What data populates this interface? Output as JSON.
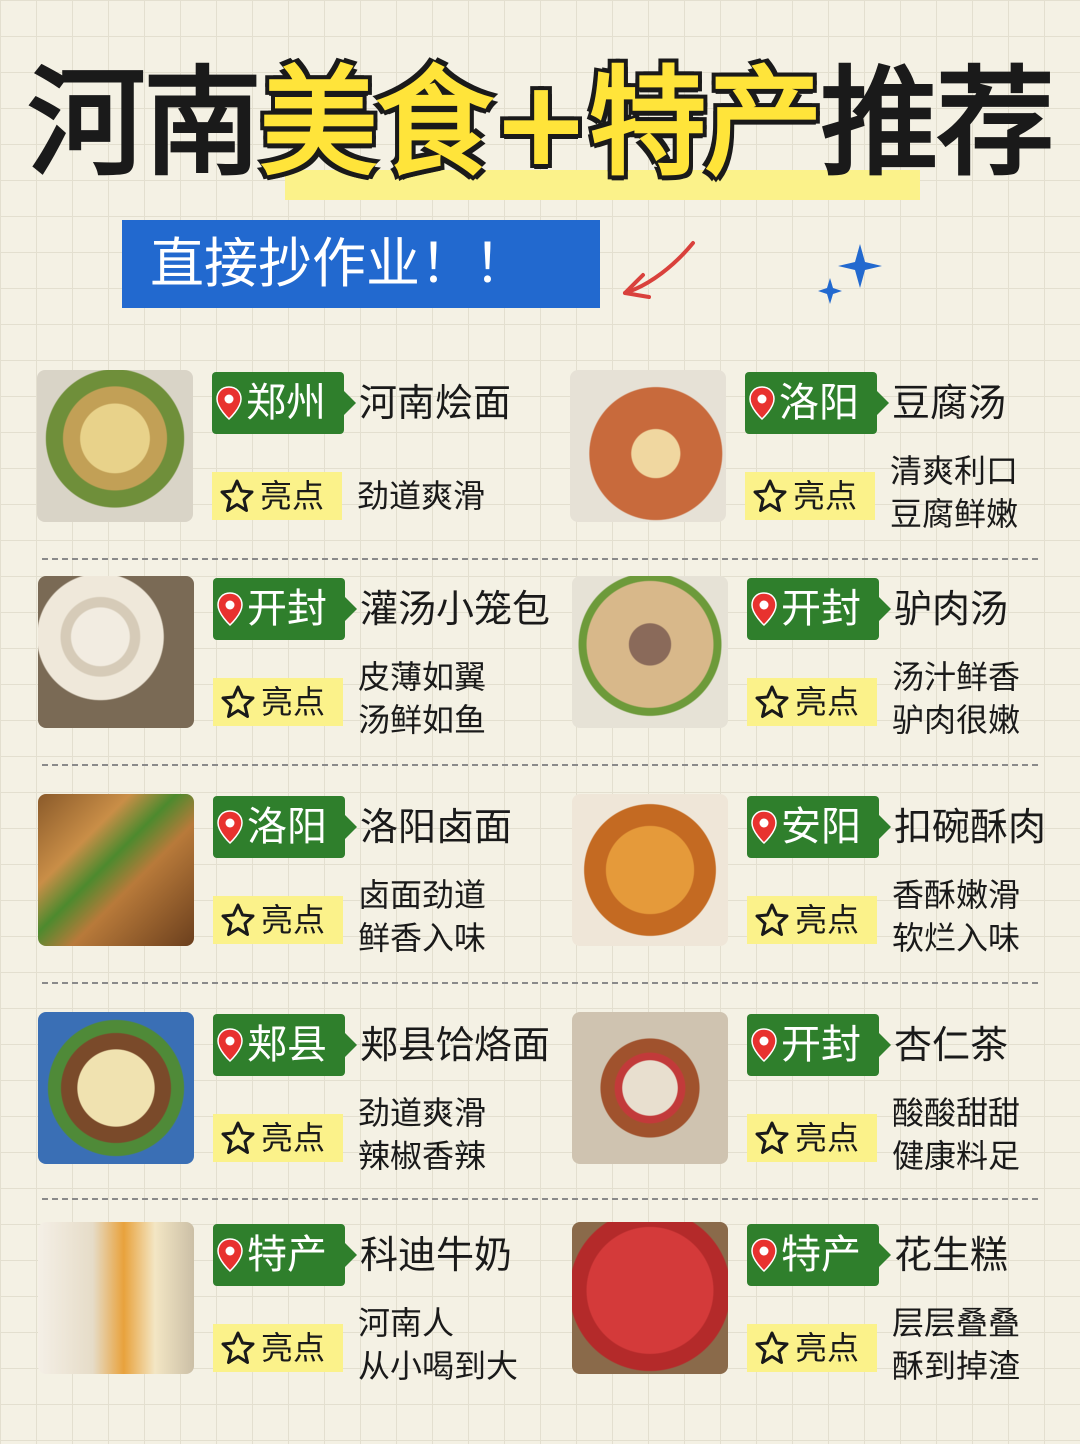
{
  "title": {
    "part1": "河南",
    "part2": "美食",
    "part3": "+",
    "part4": "特产",
    "part5": "推荐"
  },
  "banner": "直接抄作业！！",
  "highlight_label": "亮点",
  "colors": {
    "banner": "#2269cf",
    "tag_green": "#2f7f2c",
    "highlight_yellow": "#fbf28a",
    "title_yellow": "#ffe43a"
  },
  "cards": [
    {
      "location": "郑州",
      "dish": "河南烩面",
      "desc": [
        "劲道爽滑"
      ],
      "photo": "noodle-soup"
    },
    {
      "location": "洛阳",
      "dish": "豆腐汤",
      "desc": [
        "清爽利口",
        "豆腐鲜嫩"
      ],
      "photo": "tofu-soup"
    },
    {
      "location": "开封",
      "dish": "灌汤小笼包",
      "desc": [
        "皮薄如翼",
        "汤鲜如鱼"
      ],
      "photo": "soup-dumplings"
    },
    {
      "location": "开封",
      "dish": "驴肉汤",
      "desc": [
        "汤汁鲜香",
        "驴肉很嫩"
      ],
      "photo": "donkey-soup"
    },
    {
      "location": "洛阳",
      "dish": "洛阳卤面",
      "desc": [
        "卤面劲道",
        "鲜香入味"
      ],
      "photo": "braised-noodles"
    },
    {
      "location": "安阳",
      "dish": "扣碗酥肉",
      "desc": [
        "香酥嫩滑",
        "软烂入味"
      ],
      "photo": "fried-pork"
    },
    {
      "location": "郏县",
      "dish": "郏县饸烙面",
      "desc": [
        "劲道爽滑",
        "辣椒香辣"
      ],
      "photo": "helao-noodles"
    },
    {
      "location": "开封",
      "dish": "杏仁茶",
      "desc": [
        "酸酸甜甜",
        "健康料足"
      ],
      "photo": "almond-tea"
    },
    {
      "location": "特产",
      "dish": "科迪牛奶",
      "desc": [
        "河南人",
        "从小喝到大"
      ],
      "photo": "milk-packs"
    },
    {
      "location": "特产",
      "dish": "花生糕",
      "desc": [
        "层层叠叠",
        "酥到掉渣"
      ],
      "photo": "peanut-cake"
    }
  ]
}
